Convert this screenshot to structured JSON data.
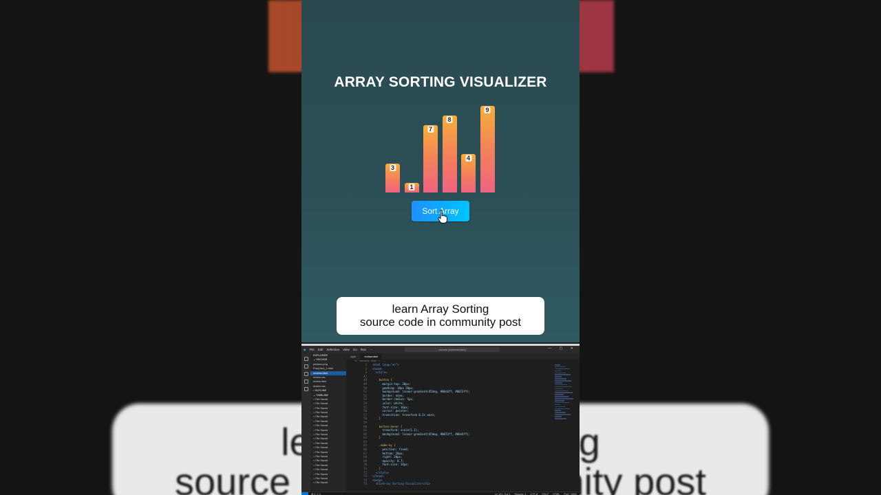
{
  "background": {
    "caption_line1": "learn Array Sorting",
    "caption_line2": "source code in community post"
  },
  "preview": {
    "title": "ARRAY SORTING VISUALIZER",
    "bars": [
      {
        "label": "3",
        "value": 3
      },
      {
        "label": "1",
        "value": 1
      },
      {
        "label": "7",
        "value": 7
      },
      {
        "label": "8",
        "value": 8
      },
      {
        "label": "4",
        "value": 4
      },
      {
        "label": "9",
        "value": 9
      }
    ],
    "button_label": "Sort Array"
  },
  "caption": {
    "line1": "learn Array Sorting",
    "line2": "source code in community post"
  },
  "vscode": {
    "menu": [
      "File",
      "Edit",
      "Selection",
      "View",
      "Go",
      "Run",
      "···"
    ],
    "command_center": "vscode [Administrator]",
    "sidebar": {
      "header": "EXPLORER",
      "section": "VSCODE",
      "files": [
        "pictures.png",
        "Prac(Jun)_1.html",
        "reviews.html",
        "review.css",
        "review.html",
        "review.css"
      ],
      "active_file": "reviews.html",
      "outline": "OUTLINE",
      "timeline": "TIMELINE",
      "timeline_item": "File Saved",
      "timeline_count": 20
    },
    "tabs": [
      "style",
      "review.html"
    ],
    "breadcrumb": "<> reviews.html > ...",
    "code": [
      {
        "n": "1",
        "t": "<html lang=\"en\">"
      },
      {
        "n": "2",
        "t": "<head>"
      },
      {
        "n": "3",
        "t": "  <style>"
      },
      {
        "n": "47",
        "t": ""
      },
      {
        "n": "48",
        "t": "    button {"
      },
      {
        "n": "49",
        "t": "      margin-top: 20px;"
      },
      {
        "n": "50",
        "t": "      padding: 10px 20px;"
      },
      {
        "n": "51",
        "t": "      background: linear-gradient(45deg, #00c6ff, #0072ff);"
      },
      {
        "n": "52",
        "t": "      border: none;"
      },
      {
        "n": "53",
        "t": "      border-radius: 5px;"
      },
      {
        "n": "54",
        "t": "      color: white;"
      },
      {
        "n": "55",
        "t": "      font-size: 16px;"
      },
      {
        "n": "56",
        "t": "      cursor: pointer;"
      },
      {
        "n": "57",
        "t": "      transition: transform 0.2s ease;"
      },
      {
        "n": "58",
        "t": "    }"
      },
      {
        "n": "59",
        "t": ""
      },
      {
        "n": "60",
        "t": "    button:hover {"
      },
      {
        "n": "61",
        "t": "      transform: scale(1.1);"
      },
      {
        "n": "62",
        "t": "      background: linear-gradient(45deg, #0072ff, #00c6ff);"
      },
      {
        "n": "63",
        "t": "    }"
      },
      {
        "n": "64",
        "t": ""
      },
      {
        "n": "65",
        "t": "    .made-by {"
      },
      {
        "n": "66",
        "t": "      position: fixed;"
      },
      {
        "n": "67",
        "t": "      bottom: 20px;"
      },
      {
        "n": "68",
        "t": "      right: 20px;"
      },
      {
        "n": "69",
        "t": "      opacity: 0.7;"
      },
      {
        "n": "70",
        "t": "      font-size: 14px;"
      },
      {
        "n": "71",
        "t": "    }"
      },
      {
        "n": "72",
        "t": "  </style>"
      },
      {
        "n": "73",
        "t": "</head>"
      },
      {
        "n": "74",
        "t": "<body>"
      },
      {
        "n": "75",
        "t": "  <h1>Array Sorting Visualizer</h1>"
      }
    ],
    "status": {
      "position": "Ln 121, Col 1",
      "spaces": "Spaces: 4",
      "encoding": "UTF-8",
      "eol": "CRLF",
      "language": "HTML",
      "port": "Port : 5500"
    }
  }
}
